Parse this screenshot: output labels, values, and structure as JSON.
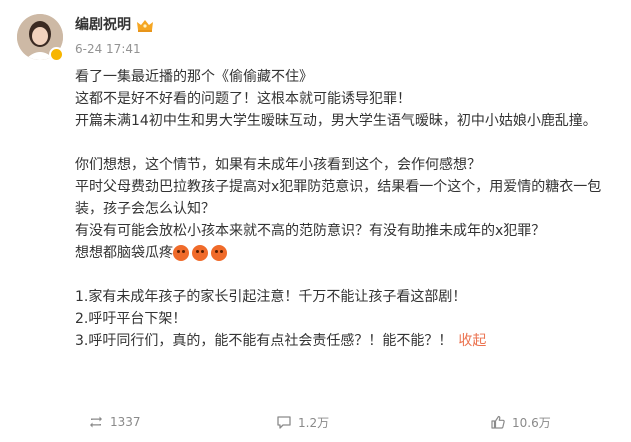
{
  "user": {
    "name": "编剧祝明",
    "time": "6-24 17:41"
  },
  "post": {
    "lines": [
      "看了一集最近播的那个《偷偷藏不住》",
      "这都不是好不好看的问题了！这根本就可能诱导犯罪！",
      "开篇未满14初中生和男大学生暧昧互动，男大学生语气暧昧，初中小姑娘小鹿乱撞。",
      "",
      "你们想想，这个情节，如果有未成年小孩看到这个，会作何感想？",
      "平时父母费劲巴拉教孩子提高对x犯罪防范意识，结果看一个这个，用爱情的糖衣一包装，孩子会怎么认知？",
      "有没有可能会放松小孩本来就不高的范防意识？有没有助推未成年的x犯罪？",
      "想想都脑袋瓜疼",
      "",
      "1.家有未成年孩子的家长引起注意！千万不能让孩子看这部剧！",
      "2.呼吁平台下架！",
      "3.呼吁同行们，真的，能不能有点社会责任感？！能不能？！"
    ],
    "collapse_label": "收起"
  },
  "actions": {
    "repost_count": "1337",
    "comment_count": "1.2万",
    "like_count": "10.6万"
  },
  "colors": {
    "accent": "#eb7350",
    "verified": "#f7b500"
  }
}
